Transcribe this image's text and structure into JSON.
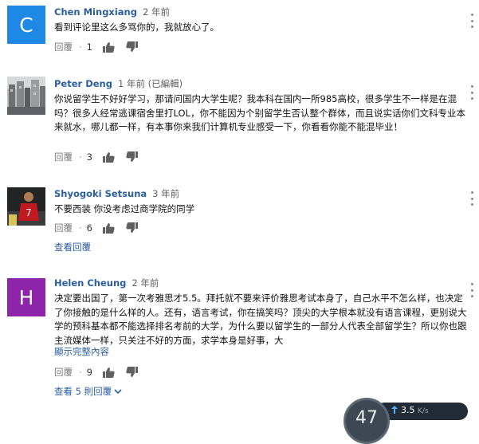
{
  "comments": [
    {
      "author": "Chen Mingxiang",
      "time": "2 年前",
      "edited": "",
      "avatar_letter": "C",
      "avatar_color": "#1e88e5",
      "text": "看到评论里这么多骂你的，我就放心了。",
      "reply_label": "回覆",
      "likes": "1"
    },
    {
      "author": "Peter Deng",
      "time": "1 年前",
      "edited": "(已編輯)",
      "avatar_letter": "",
      "avatar_color": "#8a8f95",
      "text": "你说留学生不好好学习，那请问国内大学生呢？我本科在国内一所985高校，很多学生不一样是在混吗？很多人经常逃课宿舍里打LOL，你不能因为个别留学生否认整个群体，而且说实话你们文科专业本来就水，哪儿都一样，有本事你来我们计算机专业感受一下，你看看你能不能混毕业！",
      "reply_label": "回覆",
      "likes": "3"
    },
    {
      "author": "Shyogoki Setsuna",
      "time": "3 年前",
      "edited": "",
      "avatar_letter": "",
      "avatar_color": "#1b1b1b",
      "text": "不要西装 你没考虑过商学院的同学",
      "reply_label": "回覆",
      "likes": "6",
      "view_replies": "查看回覆"
    },
    {
      "author": "Helen Cheung",
      "time": "2 年前",
      "edited": "",
      "avatar_letter": "H",
      "avatar_color": "#8e24aa",
      "text": "决定要出国了，第一次考雅思才5.5。拜托就不要来评价雅思考试本身了，自己水平不怎么样，也决定了你接触的是什么样的人。还有，语言考试，你在搞笑吗？顶尖的大学根本就没有语言课程，更别说大学的预科基本都不能选择排名考前的大学，为什么要以留学生的一部分人代表全部留学生？所以你也跟主流媒体一样，只关注不好的方面，求学本身是好事，大",
      "show_more": "顯示完整內容",
      "reply_label": "回覆",
      "likes": "9",
      "view_replies": "查看 5 則回覆"
    }
  ],
  "speed_widget": {
    "number": "47",
    "speed": "3.5",
    "unit": "K/s"
  },
  "icons": {
    "like": "thumb-up-icon",
    "dislike": "thumb-down-icon",
    "menu": "more-vert-icon",
    "expand": "chevron-down-icon",
    "upload": "arrow-up-icon"
  },
  "colors": {
    "author": "#2a5f9e",
    "link": "#2a5f9e",
    "meta": "#606060"
  }
}
